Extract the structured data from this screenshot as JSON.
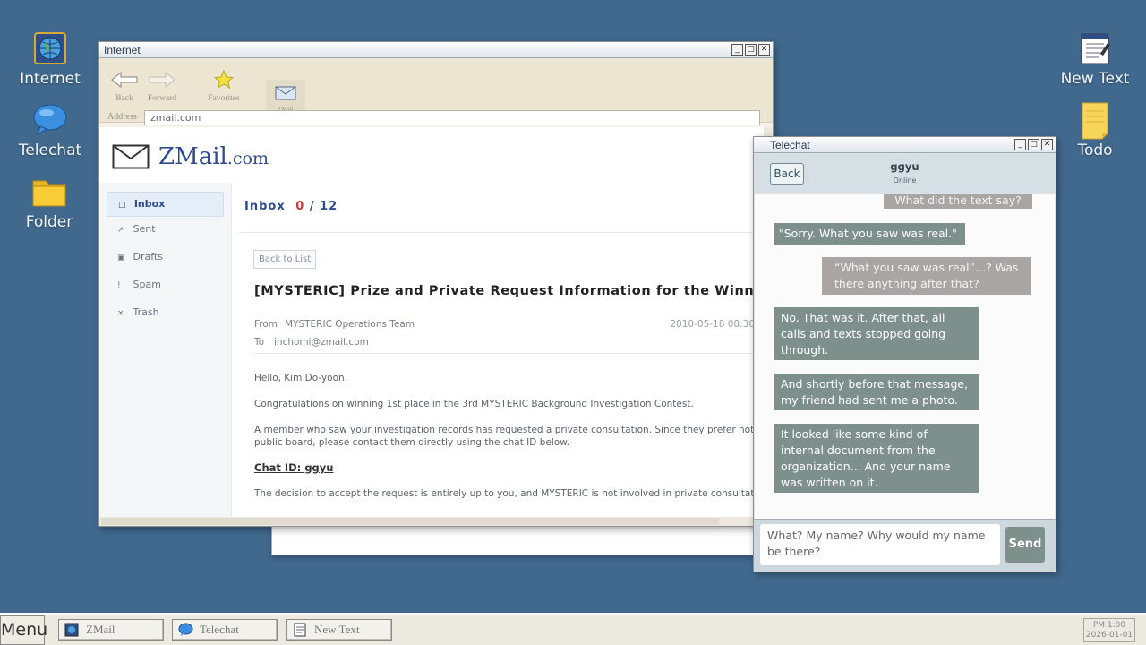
{
  "desktop": {
    "icons": [
      {
        "label": "Internet",
        "icon": "globe-icon"
      },
      {
        "label": "Telechat",
        "icon": "chat-bubble-icon"
      },
      {
        "label": "Folder",
        "icon": "folder-icon"
      },
      {
        "label": "New Text",
        "icon": "notepad-icon"
      },
      {
        "label": "Todo",
        "icon": "sticky-note-icon"
      }
    ]
  },
  "internet_window": {
    "title": "Internet",
    "toolbar": {
      "back": "Back",
      "forward": "Forward",
      "favorites": "Favorites",
      "zmail": "ZMail"
    },
    "address_label": "Address",
    "address_value": "zmail.com",
    "site": {
      "logo_main": "ZMail",
      "logo_suffix": ".com",
      "sidebar": [
        {
          "icon": "□",
          "label": "Inbox"
        },
        {
          "icon": "↗",
          "label": "Sent"
        },
        {
          "icon": "▣",
          "label": "Drafts"
        },
        {
          "icon": "!",
          "label": "Spam"
        },
        {
          "icon": "×",
          "label": "Trash"
        }
      ],
      "inbox_label": "Inbox",
      "unread": "0",
      "total": "/ 12",
      "back_to_list": "Back to List",
      "email": {
        "subject": "[MYSTERIC] Prize and Private Request Information for the Winner of the",
        "from_label": "From",
        "from": "MYSTERIC Operations Team",
        "to_label": "To",
        "to": "inchomi@zmail.com",
        "date": "2010-05-18 08:30",
        "greeting": "Hello, Kim Do-yoon.",
        "para1": "Congratulations on winning 1st place in the 3rd MYSTERIC Background Investigation Contest.",
        "para2_line1": "A member who saw your investigation records has requested a private consultation. Since they prefer not to use the",
        "para2_line2": "public board, please contact them directly using the chat ID below.",
        "chat_id": "Chat ID: ggyu",
        "para3": "The decision to accept the request is entirely up to you, and MYSTERIC is not involved in private consultations betw"
      }
    }
  },
  "telechat_window": {
    "title": "Telechat",
    "back": "Back",
    "contact_name": "ggyu",
    "contact_status": "Online",
    "messages": [
      {
        "side": "right",
        "text": "What did the text say?"
      },
      {
        "side": "left",
        "text": "\"Sorry. What you saw was real.\""
      },
      {
        "side": "right",
        "text": "“What you saw was real”...? Was there anything after that?"
      },
      {
        "side": "left",
        "text": "No. That was it. After that, all calls and texts stopped going through."
      },
      {
        "side": "left",
        "text": "And shortly before that message, my friend had sent me a photo."
      },
      {
        "side": "left",
        "text": "It looked like some kind of internal document from the organization... And your name was written on it."
      }
    ],
    "input_value": "What? My name? Why would my name be there?",
    "send": "Send"
  },
  "taskbar": {
    "menu": "Menu",
    "tasks": [
      {
        "label": "ZMail",
        "icon": "browser-icon"
      },
      {
        "label": "Telechat",
        "icon": "chat-bubble-icon"
      },
      {
        "label": "New Text",
        "icon": "notepad-icon"
      }
    ],
    "clock_time": "PM 1:00",
    "clock_date": "2026-01-01"
  }
}
